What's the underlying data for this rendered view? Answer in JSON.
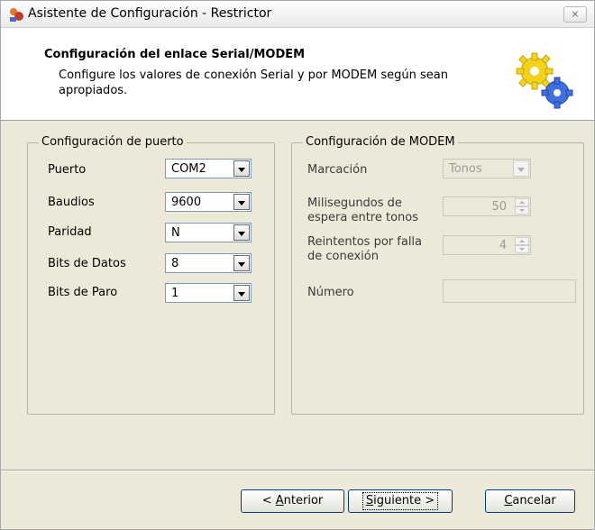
{
  "window": {
    "title": "Asistente de Configuración - Restrictor",
    "close_glyph": "⨯"
  },
  "header": {
    "title": "Configuración del enlace Serial/MODEM",
    "description": "Configure los valores de conexión Serial y por MODEM según sean apropiados.",
    "icon": "gears-icon"
  },
  "port_group": {
    "legend": "Configuración de puerto",
    "fields": [
      {
        "label": "Puerto",
        "value": "COM2"
      },
      {
        "label": "Baudios",
        "value": "9600"
      },
      {
        "label": "Paridad",
        "value": "N"
      },
      {
        "label": "Bits de Datos",
        "value": "8"
      },
      {
        "label": "Bits de Paro",
        "value": "1"
      }
    ]
  },
  "modem_group": {
    "legend": "Configuración de MODEM",
    "dial_label": "Marcación",
    "dial_value": "Tonos",
    "wait_label": "Milisegundos de espera entre tonos",
    "wait_value": "50",
    "retries_label": "Reintentos por falla de conexión",
    "retries_value": "4",
    "number_label": "Número",
    "number_value": ""
  },
  "buttons": {
    "back_prefix": "< ",
    "back_mnemonic": "A",
    "back_rest": "nterior",
    "next_mnemonic": "S",
    "next_rest": "iguiente >",
    "cancel_mnemonic": "C",
    "cancel_rest": "ancelar"
  },
  "colors": {
    "dialog_bg": "#ece9d8",
    "header_bg": "#ffffff",
    "button_border": "#003c74"
  }
}
